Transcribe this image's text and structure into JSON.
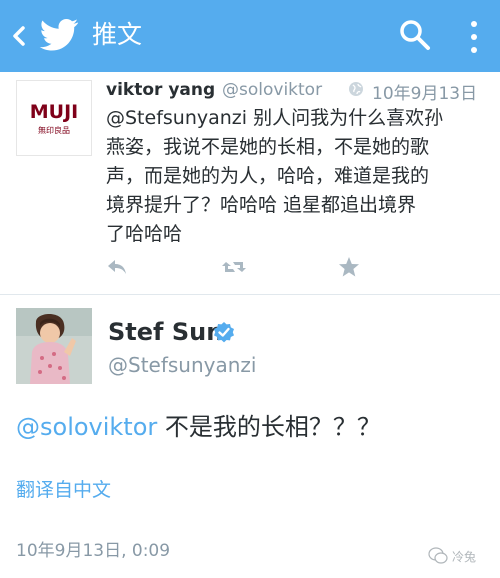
{
  "header": {
    "title": "推文"
  },
  "tweet1": {
    "author_name": "viktor yang",
    "author_handle": "@soloviktor",
    "date": "10年9月13日",
    "avatar_brand": "MUJI",
    "avatar_subtitle": "無印良品",
    "text_lines": [
      "@Stefsunyanzi 别人问我为什么喜欢孙",
      "燕姿，我说不是她的长相，不是她的歌",
      "声，而是她的为人，哈哈，难道是我的",
      "境界提升了？哈哈哈 追星都追出境界",
      "了哈哈哈"
    ]
  },
  "tweet2": {
    "author_name": "Stef Sun",
    "author_handle": "@Stefsunyanzi",
    "mention": "@soloviktor",
    "text": " 不是我的长相？？？",
    "translate_label": "翻译自中文",
    "timestamp": "10年9月13日, 0:09"
  },
  "watermark": {
    "label": "冷兔"
  },
  "colors": {
    "header_bg": "#55acee",
    "link": "#55acee",
    "secondary_text": "#8899a6",
    "primary_text": "#292f33"
  }
}
